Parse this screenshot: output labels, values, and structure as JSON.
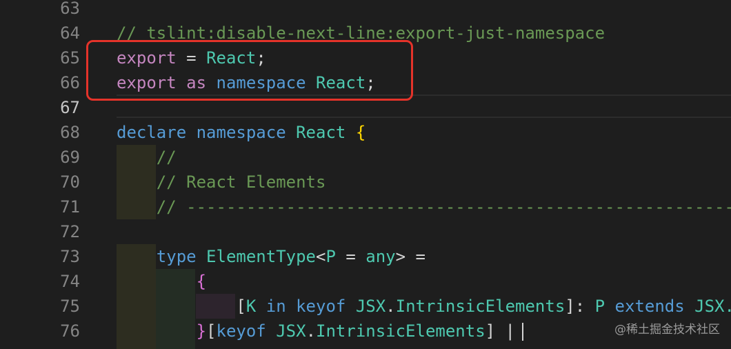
{
  "editor": {
    "current_line": 67,
    "lines": [
      {
        "number": "63",
        "tokens": []
      },
      {
        "number": "64",
        "tokens": [
          {
            "t": "// tslint:disable-next-line:export-just-namespace",
            "c": "comment"
          }
        ]
      },
      {
        "number": "65",
        "tokens": [
          {
            "t": "export",
            "c": "keyword-flow"
          },
          {
            "t": " = ",
            "c": "punc"
          },
          {
            "t": "React",
            "c": "type"
          },
          {
            "t": ";",
            "c": "punc"
          }
        ]
      },
      {
        "number": "66",
        "tokens": [
          {
            "t": "export",
            "c": "keyword-flow"
          },
          {
            "t": " ",
            "c": "punc"
          },
          {
            "t": "as",
            "c": "keyword-flow"
          },
          {
            "t": " ",
            "c": "punc"
          },
          {
            "t": "namespace",
            "c": "keyword"
          },
          {
            "t": " ",
            "c": "punc"
          },
          {
            "t": "React",
            "c": "type"
          },
          {
            "t": ";",
            "c": "punc"
          }
        ]
      },
      {
        "number": "67",
        "tokens": []
      },
      {
        "number": "68",
        "tokens": [
          {
            "t": "declare",
            "c": "keyword"
          },
          {
            "t": " ",
            "c": "punc"
          },
          {
            "t": "namespace",
            "c": "keyword"
          },
          {
            "t": " ",
            "c": "punc"
          },
          {
            "t": "React",
            "c": "type"
          },
          {
            "t": " ",
            "c": "punc"
          },
          {
            "t": "{",
            "c": "brace"
          }
        ]
      },
      {
        "number": "69",
        "tokens": [
          {
            "t": "    //",
            "c": "comment"
          }
        ]
      },
      {
        "number": "70",
        "tokens": [
          {
            "t": "    // React Elements",
            "c": "comment"
          }
        ]
      },
      {
        "number": "71",
        "tokens": [
          {
            "t": "    // ----------------------------------------------------------------------",
            "c": "comment"
          }
        ]
      },
      {
        "number": "72",
        "tokens": []
      },
      {
        "number": "73",
        "tokens": [
          {
            "t": "    ",
            "c": "punc"
          },
          {
            "t": "type",
            "c": "keyword"
          },
          {
            "t": " ",
            "c": "punc"
          },
          {
            "t": "ElementType",
            "c": "type"
          },
          {
            "t": "<",
            "c": "punc"
          },
          {
            "t": "P",
            "c": "type"
          },
          {
            "t": " = ",
            "c": "punc"
          },
          {
            "t": "any",
            "c": "type"
          },
          {
            "t": "> =",
            "c": "punc"
          }
        ]
      },
      {
        "number": "74",
        "tokens": [
          {
            "t": "        ",
            "c": "punc"
          },
          {
            "t": "{",
            "c": "brace-2"
          }
        ]
      },
      {
        "number": "75",
        "tokens": [
          {
            "t": "            [",
            "c": "punc"
          },
          {
            "t": "K",
            "c": "type"
          },
          {
            "t": " ",
            "c": "punc"
          },
          {
            "t": "in",
            "c": "keyword"
          },
          {
            "t": " ",
            "c": "punc"
          },
          {
            "t": "keyof",
            "c": "keyword"
          },
          {
            "t": " ",
            "c": "punc"
          },
          {
            "t": "JSX",
            "c": "ns"
          },
          {
            "t": ".",
            "c": "punc"
          },
          {
            "t": "IntrinsicElements",
            "c": "type"
          },
          {
            "t": "]: ",
            "c": "punc"
          },
          {
            "t": "P",
            "c": "type"
          },
          {
            "t": " ",
            "c": "punc"
          },
          {
            "t": "extends",
            "c": "keyword"
          },
          {
            "t": " ",
            "c": "punc"
          },
          {
            "t": "JSX.",
            "c": "ns"
          }
        ]
      },
      {
        "number": "76",
        "tokens": [
          {
            "t": "        ",
            "c": "punc"
          },
          {
            "t": "}",
            "c": "brace-2"
          },
          {
            "t": "[",
            "c": "punc"
          },
          {
            "t": "keyof",
            "c": "keyword"
          },
          {
            "t": " ",
            "c": "punc"
          },
          {
            "t": "JSX",
            "c": "ns"
          },
          {
            "t": ".",
            "c": "punc"
          },
          {
            "t": "IntrinsicElements",
            "c": "type"
          },
          {
            "t": "]",
            "c": "punc"
          },
          {
            "t": " |",
            "c": "punc"
          }
        ]
      }
    ]
  },
  "watermark": "@稀土掘金技术社区",
  "colors": {
    "background": "#1e1e1e",
    "highlight_box": "#e5332a",
    "comment": "#6a9955",
    "keyword": "#569cd6",
    "keyword_flow": "#c586c0",
    "type": "#4ec9b0"
  }
}
